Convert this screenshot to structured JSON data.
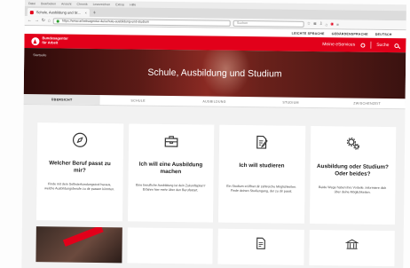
{
  "browser": {
    "menu": [
      "Datei",
      "Bearbeiten",
      "Ansicht",
      "Chronik",
      "Lesezeichen",
      "Extras",
      "Hilfe"
    ],
    "tab_title": "Schule, Ausbildung und St…",
    "tab_close": "×",
    "new_tab": "+",
    "url": "https://www.arbeitsagentur.de/schule-ausbildung-und-studium",
    "search_placeholder": "Suchen",
    "nav": {
      "back": "←",
      "forward": "→",
      "reload": "↻",
      "home": "⌂"
    },
    "toolbar": {
      "star": "☆",
      "bookmarks": "≣",
      "download": "⇩",
      "home": "⌂",
      "pocket": "◉",
      "menu": "≡"
    }
  },
  "site": {
    "a11y": [
      "LEICHTE SPRACHE",
      "GEBÄRDENSPRACHE",
      "DEUTSCH"
    ],
    "logo": [
      "Bundesagentur",
      "für Arbeit"
    ],
    "header_menu": "Meine eServices",
    "header_search": "Suche",
    "brand_color": "#e2001a",
    "breadcrumb": "Startseite",
    "hero_title": "Schule, Ausbildung und Studium",
    "tabs": [
      "ÜBERSICHT",
      "SCHULE",
      "AUSBILDUNG",
      "STUDIUM",
      "ZWISCHENZEIT"
    ],
    "cards": [
      {
        "icon": "compass-icon",
        "title": "Welcher Beruf passt zu mir?",
        "text": "Finde mit dem Selbsterkundungstool heraus, welche Ausbildungsberufe zu dir passen könnten."
      },
      {
        "icon": "toolbox-icon",
        "title": "Ich will eine Ausbildung machen",
        "text": "Eine berufliche Ausbildung ist dein Zukunftsplan? Erfahre hier mehr über den Berufsstart."
      },
      {
        "icon": "pen-document-icon",
        "title": "Ich will studieren",
        "text": "Ein Studium eröffnet dir zahlreiche Möglichkeiten. Finde deinen Studiengang, der zu dir passt."
      },
      {
        "icon": "gears-icon",
        "title": "Ausbildung oder Studium? Oder beides?",
        "text": "Beide Wege haben ihre Vorteile. Informiere dich über deine Möglichkeiten."
      }
    ],
    "lower_cards": [
      "photo-card",
      "document-icon",
      "building-icon"
    ]
  }
}
